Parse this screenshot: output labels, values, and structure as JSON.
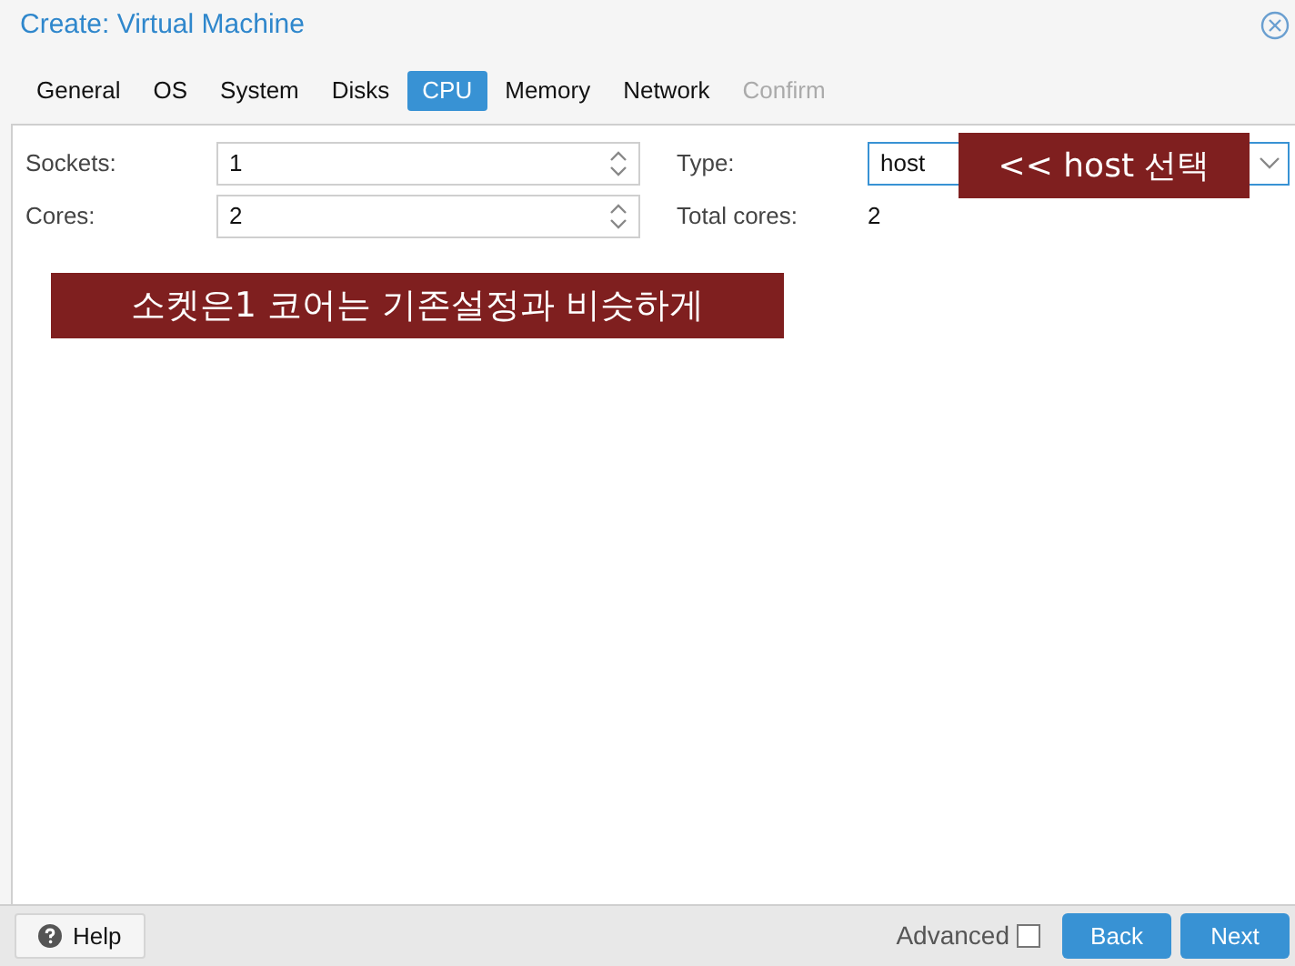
{
  "window": {
    "title": "Create: Virtual Machine"
  },
  "tabs": [
    {
      "label": "General",
      "selected": false,
      "disabled": false
    },
    {
      "label": "OS",
      "selected": false,
      "disabled": false
    },
    {
      "label": "System",
      "selected": false,
      "disabled": false
    },
    {
      "label": "Disks",
      "selected": false,
      "disabled": false
    },
    {
      "label": "CPU",
      "selected": true,
      "disabled": false
    },
    {
      "label": "Memory",
      "selected": false,
      "disabled": false
    },
    {
      "label": "Network",
      "selected": false,
      "disabled": false
    },
    {
      "label": "Confirm",
      "selected": false,
      "disabled": true
    }
  ],
  "left_fields": [
    {
      "label": "Sockets:",
      "value": "1"
    },
    {
      "label": "Cores:",
      "value": "2"
    }
  ],
  "type_field": {
    "label": "Type:",
    "value": "host"
  },
  "total_cores": {
    "label": "Total cores:",
    "value": "2"
  },
  "annotations": [
    {
      "text": "<< host 선택"
    },
    {
      "text": "소켓은1 코어는 기존설정과 비슷하게"
    }
  ],
  "footer": {
    "help": "Help",
    "advanced": {
      "label": "Advanced",
      "checked": false
    },
    "buttons": [
      "Back",
      "Next"
    ]
  }
}
